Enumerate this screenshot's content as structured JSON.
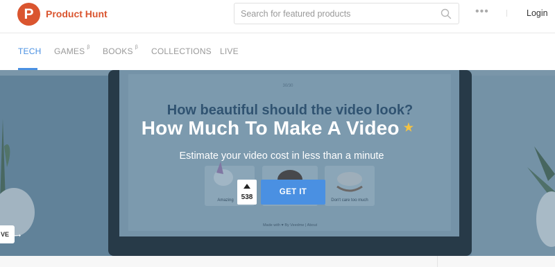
{
  "header": {
    "logo_letter": "P",
    "brand": "Product Hunt",
    "search_placeholder": "Search for featured products",
    "more_label": "•••",
    "login_label": "Login"
  },
  "tabs": [
    {
      "label": "TECH",
      "beta": ""
    },
    {
      "label": "GAMES",
      "beta": "β"
    },
    {
      "label": "BOOKS",
      "beta": "β"
    },
    {
      "label": "COLLECTIONS",
      "beta": ""
    },
    {
      "label": "LIVE",
      "beta": ""
    }
  ],
  "hero": {
    "title": "How Much To Make A Video",
    "star": "★",
    "subtitle": "Estimate your video cost in less than a minute",
    "vote_count": "538",
    "cta_label": "GET IT",
    "side_chip": "VE",
    "side_arrow": "→",
    "screen_headline": "How beautiful should the video look?",
    "screen_page": "30/30",
    "screen_caption_left": "Amazing",
    "screen_caption_right": "Don't care too much",
    "screen_footer": "Made with ♥ By Veedme | About"
  },
  "colors": {
    "brand": "#da552f",
    "accent": "#4a90e2",
    "star": "#f5c342"
  }
}
